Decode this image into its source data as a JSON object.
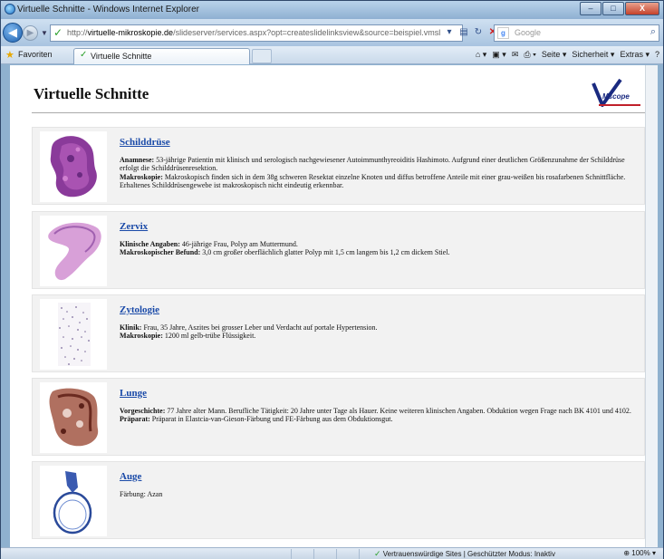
{
  "window": {
    "title": "Virtuelle Schnitte - Windows Internet Explorer",
    "controls": {
      "minimize": "–",
      "maximize": "□",
      "close": "X"
    }
  },
  "addressbar": {
    "url_prefix": "http://",
    "url_host": "virtuelle-mikroskopie.de",
    "url_rest": "/slideserver/services.aspx?opt=createslidelinksview&source=beispiel.vmsl",
    "search_placeholder": "Google"
  },
  "favbar": {
    "favorites_label": "Favoriten",
    "tab_label": "Virtuelle Schnitte",
    "commands": [
      "Seite ▾",
      "Sicherheit ▾",
      "Extras ▾"
    ]
  },
  "page": {
    "title": "Virtuelle Schnitte",
    "logo_text": "Mscope"
  },
  "cases": [
    {
      "title": "Schilddrüse",
      "lines": [
        {
          "label": "Anamnese:",
          "text": " 53-jährige Patientin mit klinisch und serologisch nachgewiesener Autoimmunthyreoiditis Hashimoto. Aufgrund einer deutlichen Größenzunahme der Schilddrüse erfolgt die Schilddrüsenresektion."
        },
        {
          "label": "Makroskopie:",
          "text": " Makroskopisch finden sich in dem 38g schweren Resektat einzelne Knoten und diffus betroffene Anteile mit einer grau-weißen bis rosafarbenen Schnittfläche. Erhaltenes Schilddrüsengewebe ist makroskopisch nicht eindeutig erkennbar."
        }
      ]
    },
    {
      "title": "Zervix",
      "lines": [
        {
          "label": "Klinische Angaben:",
          "text": " 46-jährige Frau, Polyp am Muttermund."
        },
        {
          "label": "Makroskopischer Befund:",
          "text": " 3,0 cm großer oberflächlich glatter Polyp mit 1,5 cm langem bis 1,2 cm dickem Stiel."
        }
      ]
    },
    {
      "title": "Zytologie",
      "lines": [
        {
          "label": "Klinik:",
          "text": " Frau, 35 Jahre, Aszites bei grosser Leber und Verdacht auf portale Hypertension."
        },
        {
          "label": "Makroskopie:",
          "text": " 1200 ml gelb-trübe Flüssigkeit."
        }
      ]
    },
    {
      "title": "Lunge",
      "lines": [
        {
          "label": "Vorgeschichte:",
          "text": " 77 Jahre alter Mann. Berufliche Tätigkeit: 20 Jahre unter Tage als Hauer. Keine weiteren klinischen Angaben. Obduktion wegen Frage nach BK 4101 und 4102."
        },
        {
          "label": "Präparat:",
          "text": " Präparat in Elastcia-van-Gieson-Färbung und FE-Färbung aus dem Obduktionsgut."
        }
      ]
    },
    {
      "title": "Auge",
      "lines": [
        {
          "label": "",
          "text": "Färbung: Azan"
        }
      ]
    }
  ],
  "statusbar": {
    "zone": "Vertrauenswürdige Sites | Geschützter Modus: Inaktiv",
    "zoom": "100%"
  },
  "colors": {
    "link": "#1a4aa8",
    "card_bg": "#f2f2f2"
  }
}
